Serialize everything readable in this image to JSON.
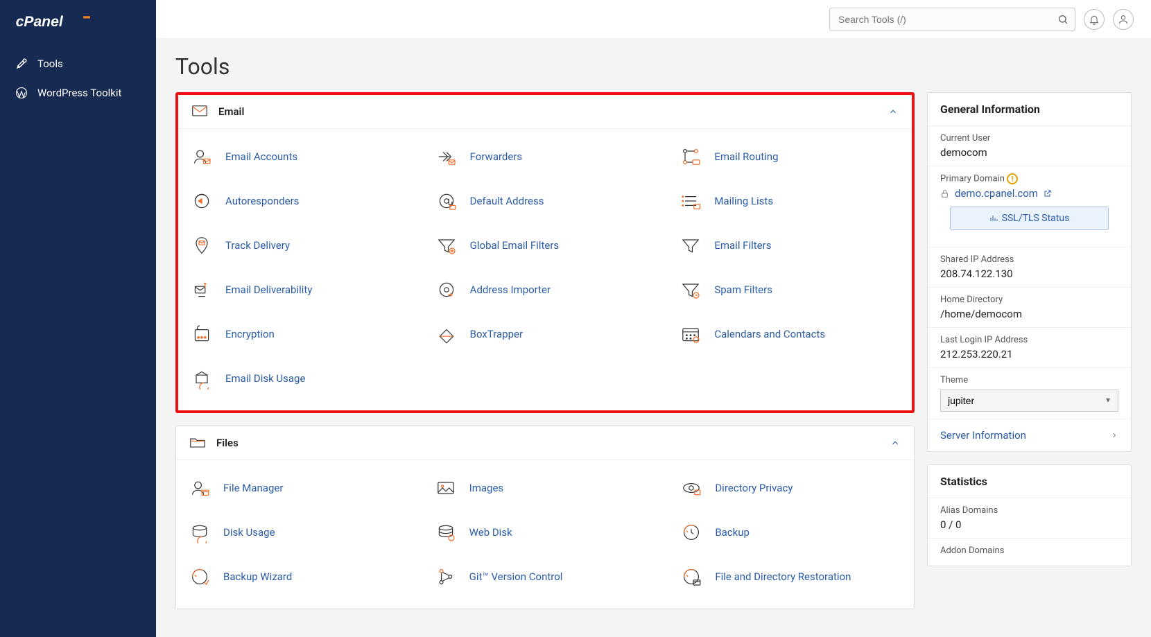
{
  "search": {
    "placeholder": "Search Tools (/)"
  },
  "page_title": "Tools",
  "sidebar": {
    "items": [
      {
        "label": "Tools",
        "icon": "tools-icon"
      },
      {
        "label": "WordPress Toolkit",
        "icon": "wordpress-icon"
      }
    ]
  },
  "sections": [
    {
      "title": "Email",
      "highlight": true,
      "tools": [
        "Email Accounts",
        "Forwarders",
        "Email Routing",
        "Autoresponders",
        "Default Address",
        "Mailing Lists",
        "Track Delivery",
        "Global Email Filters",
        "Email Filters",
        "Email Deliverability",
        "Address Importer",
        "Spam Filters",
        "Encryption",
        "BoxTrapper",
        "Calendars and Contacts",
        "Email Disk Usage"
      ]
    },
    {
      "title": "Files",
      "highlight": false,
      "tools": [
        "File Manager",
        "Images",
        "Directory Privacy",
        "Disk Usage",
        "Web Disk",
        "Backup",
        "Backup Wizard",
        "Git™ Version Control",
        "File and Directory Restoration"
      ]
    }
  ],
  "general_info": {
    "title": "General Information",
    "current_user_label": "Current User",
    "current_user": "democom",
    "primary_domain_label": "Primary Domain",
    "primary_domain": "demo.cpanel.com",
    "ssl_status": "SSL/TLS Status",
    "shared_ip_label": "Shared IP Address",
    "shared_ip": "208.74.122.130",
    "home_dir_label": "Home Directory",
    "home_dir": "/home/democom",
    "last_login_label": "Last Login IP Address",
    "last_login": "212.253.220.21",
    "theme_label": "Theme",
    "theme": "jupiter",
    "server_info": "Server Information"
  },
  "statistics": {
    "title": "Statistics",
    "alias_label": "Alias Domains",
    "alias_value": "0 / 0",
    "addon_label": "Addon Domains"
  }
}
